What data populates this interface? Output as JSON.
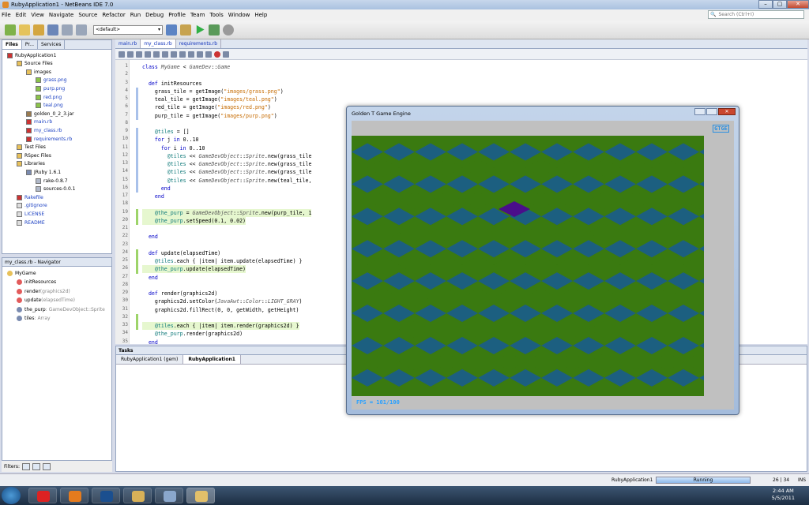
{
  "window": {
    "title": "RubyApplication1 - NetBeans IDE 7.0",
    "min": "–",
    "max": "▢",
    "close": "✕"
  },
  "menu": [
    "File",
    "Edit",
    "View",
    "Navigate",
    "Source",
    "Refactor",
    "Run",
    "Debug",
    "Profile",
    "Team",
    "Tools",
    "Window",
    "Help"
  ],
  "search": {
    "placeholder": "Search (Ctrl+I)"
  },
  "toolbar": {
    "config": "<default>"
  },
  "projects": {
    "tabs": [
      "Files",
      "Pr...",
      "Services"
    ],
    "tree": [
      {
        "label": "RubyApplication1",
        "level": 0,
        "icon": "ruby-project-icon"
      },
      {
        "label": "Source Files",
        "level": 1,
        "icon": "folder-icon"
      },
      {
        "label": "images",
        "level": 2,
        "icon": "folder-icon"
      },
      {
        "label": "grass.png",
        "level": 3,
        "icon": "image-file-icon"
      },
      {
        "label": "purp.png",
        "level": 3,
        "icon": "image-file-icon"
      },
      {
        "label": "red.png",
        "level": 3,
        "icon": "image-file-icon"
      },
      {
        "label": "teal.png",
        "level": 3,
        "icon": "image-file-icon"
      },
      {
        "label": "golden_0_2_3.jar",
        "level": 2,
        "icon": "jar-icon"
      },
      {
        "label": "main.rb",
        "level": 2,
        "icon": "ruby-file-icon"
      },
      {
        "label": "my_class.rb",
        "level": 2,
        "icon": "ruby-file-icon"
      },
      {
        "label": "requirements.rb",
        "level": 2,
        "icon": "ruby-file-icon"
      },
      {
        "label": "Test Files",
        "level": 1,
        "icon": "folder-icon"
      },
      {
        "label": "RSpec Files",
        "level": 1,
        "icon": "folder-icon"
      },
      {
        "label": "Libraries",
        "level": 1,
        "icon": "folder-icon"
      },
      {
        "label": "JRuby 1.6.1",
        "level": 2,
        "icon": "library-icon"
      },
      {
        "label": "rake-0.8.7",
        "level": 3,
        "icon": "gem-icon"
      },
      {
        "label": "sources-0.0.1",
        "level": 3,
        "icon": "gem-icon"
      },
      {
        "label": "Rakefile",
        "level": 1,
        "icon": "ruby-file-icon"
      },
      {
        "label": ".gitignore",
        "level": 1,
        "icon": "text-file-icon"
      },
      {
        "label": "LICENSE",
        "level": 1,
        "icon": "text-file-icon"
      },
      {
        "label": "README",
        "level": 1,
        "icon": "text-file-icon"
      }
    ]
  },
  "navigator": {
    "title": "my_class.rb - Navigator",
    "items": [
      {
        "label": "MyGame",
        "level": 0,
        "detail": ""
      },
      {
        "label": "initResources",
        "level": 1,
        "detail": ""
      },
      {
        "label": "render",
        "level": 1,
        "detail": "(graphics2d)"
      },
      {
        "label": "update",
        "level": 1,
        "detail": "(elapsedTime)"
      },
      {
        "label": "the_purp",
        "level": 1,
        "detail": " : GameDevObject::Sprite"
      },
      {
        "label": "tiles",
        "level": 1,
        "detail": " : Array"
      }
    ],
    "filters_label": "Filters:"
  },
  "editor": {
    "tabs": [
      "main.rb",
      "my_class.rb",
      "requirements.rb"
    ],
    "lines": [
      "class MyGame < GameDev::Game",
      "",
      "  def initResources",
      "    grass_tile = getImage(\"images/grass.png\")",
      "    teal_tile = getImage(\"images/teal.png\")",
      "    red_tile = getImage(\"images/red.png\")",
      "    purp_tile = getImage(\"images/purp.png\")",
      "",
      "    @tiles = []",
      "    for j in 0..10",
      "      for i in 0..10",
      "        @tiles << GameDevObject::Sprite.new(grass_tile",
      "        @tiles << GameDevObject::Sprite.new(grass_tile",
      "        @tiles << GameDevObject::Sprite.new(grass_tile",
      "        @tiles << GameDevObject::Sprite.new(teal_tile,",
      "      end",
      "    end",
      "",
      "    @the_purp = GameDevObject::Sprite.new(purp_tile, 1",
      "    @the_purp.setSpeed(0.1, 0.02)",
      "",
      "  end",
      "",
      "  def update(elapsedTime)",
      "    @tiles.each { |item| item.update(elapsedTime) }",
      "    @the_purp.update(elapsedTime)",
      "  end",
      "",
      "  def render(graphics2d)",
      "    graphics2d.setColor(JavaAwt::Color::LIGHT_GRAY)",
      "    graphics2d.fillRect(0, 0, getWidth, getHeight)",
      "",
      "    @tiles.each { |item| item.render(graphics2d) }",
      "    @the_purp.render(graphics2d)",
      "  end"
    ]
  },
  "tasks": {
    "title": "Tasks",
    "output_tabs": [
      "RubyApplication1 (gem)",
      "RubyApplication1"
    ]
  },
  "status": {
    "project": "RubyApplication1",
    "progress": "Running",
    "position": "26 | 34",
    "mode": "INS"
  },
  "game": {
    "title": "Golden T Game Engine",
    "logo": "GTGE",
    "fps": "FPS = 101/100",
    "colors": {
      "grass": "#3a7a10",
      "teal": "#1c5f80",
      "purp": "#4a0e8a"
    }
  },
  "taskbar": {
    "time": "2:44 AM",
    "date": "5/5/2011"
  }
}
